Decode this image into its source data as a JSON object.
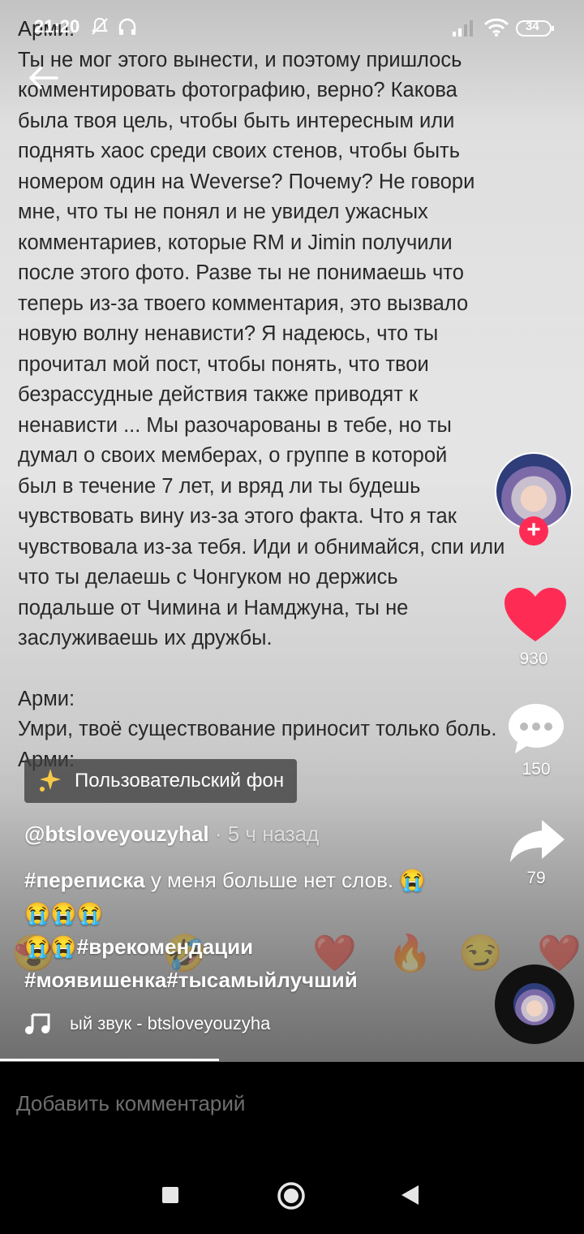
{
  "status_bar": {
    "time": "21:20",
    "battery": "34"
  },
  "post_text": {
    "lines": [
      "Арми:",
      "Ты не мог этого вынести, и поэтому пришлось",
      "комментировать фотографию, верно? Какова",
      "была твоя цель, чтобы быть интересным или",
      "поднять хаос среди своих стенов, чтобы быть",
      "номером один на Weverse? Почему? Не говори",
      "мне, что ты не понял и не увидел ужасных",
      "комментариев, которые RM и Jimin получили",
      "после этого фото. Разве ты не понимаешь что",
      "теперь из-за твоего комментария, это вызвало",
      "новую волну ненависти? Я надеюсь, что ты",
      "прочитал мой пост, чтобы понять, что твои",
      "безрассудные действия также приводят к",
      "ненависти ... Мы разочарованы в тебе, но ты",
      "думал о своих мемберах, о группе в которой",
      "был в течение 7 лет, и вряд ли ты будешь",
      "чувствовать вину из-за этого факта. Что я так",
      "чувствовала из-за тебя. Иди и обнимайся, спи или",
      "что ты делаешь с Чонгуком но держись",
      "подальше от Чимина и Намджуна, ты не",
      "заслуживаешь их дружбы."
    ],
    "lines_after": [
      "Арми:",
      "Умри, твоё существование приносит только боль.",
      "Арми:"
    ]
  },
  "right_rail": {
    "likes": "930",
    "comments": "150",
    "shares": "79"
  },
  "badge": {
    "label": "Пользовательский фон"
  },
  "post": {
    "author": "@btsloveyouzyhal",
    "time": " · 5 ч назад",
    "caption_tag1": "#переписка",
    "caption_text1": " у меня больше нет слов. ",
    "caption_emojis1": "😭😭😭😭",
    "caption_emojis2": "😭😭",
    "caption_tag2": "#врекомендации",
    "caption_tags3": "#моявишенка#тысамыйлучший",
    "sound": "ый звук - btsloveyouzyha"
  },
  "comment_bar": {
    "placeholder": "Добавить комментарий"
  },
  "reactions": [
    "😍",
    "🤣",
    "❤️",
    "🔥",
    "😏",
    "❤️"
  ],
  "colors": {
    "like": "#fe2c55",
    "follow": "#fe2c55"
  }
}
